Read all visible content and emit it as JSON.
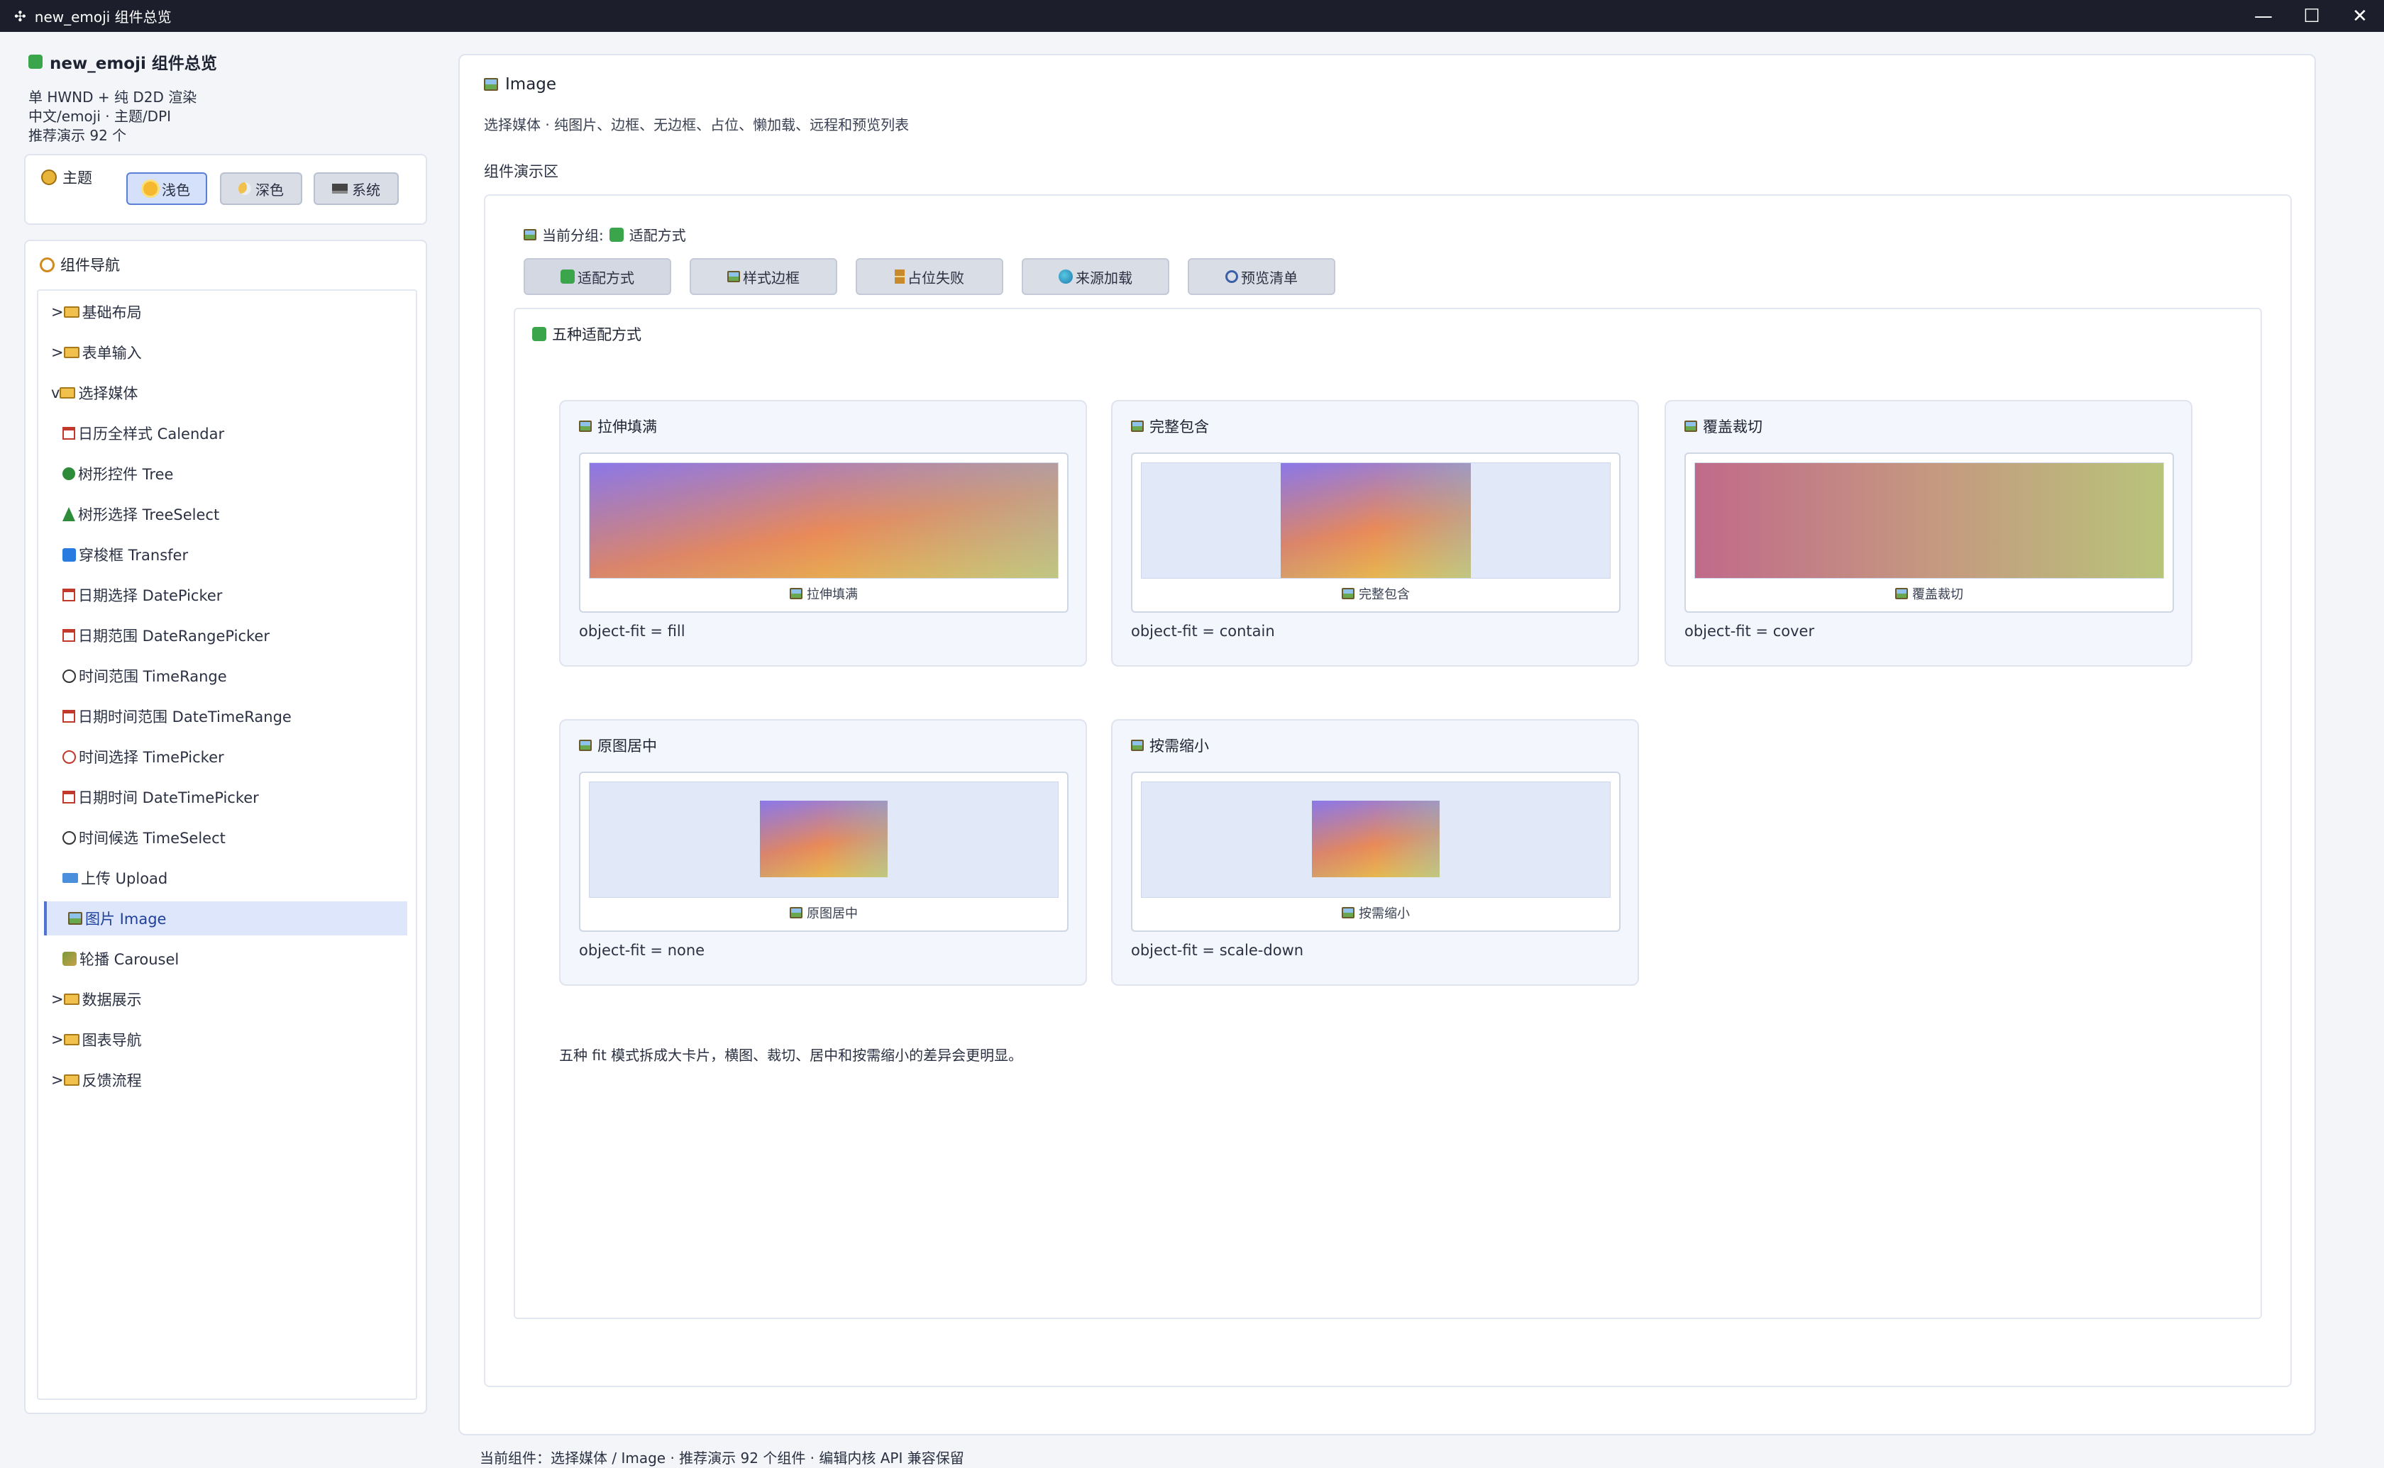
{
  "window": {
    "title": "new_emoji 组件总览",
    "minimize": "—",
    "maximize": "☐",
    "close": "✕"
  },
  "sidebar": {
    "app_name": "new_emoji 组件总览",
    "info_lines": [
      "单 HWND + 纯 D2D 渲染",
      "中文/emoji · 主题/DPI",
      "推荐演示 92 个"
    ],
    "theme": {
      "label": "主题",
      "buttons": [
        {
          "label": "浅色",
          "icon": "sun-icon",
          "active": true
        },
        {
          "label": "深色",
          "icon": "moon-icon",
          "active": false
        },
        {
          "label": "系统",
          "icon": "laptop-icon",
          "active": false
        }
      ]
    },
    "nav": {
      "label": "组件导航",
      "items": [
        {
          "prefix": ">",
          "label": "基础布局",
          "icon": "folder-icon"
        },
        {
          "prefix": ">",
          "label": "表单输入",
          "icon": "folder-icon"
        },
        {
          "prefix": "v",
          "label": "选择媒体",
          "icon": "folder-icon"
        },
        {
          "label": "日历全样式 Calendar",
          "icon": "calendar-icon"
        },
        {
          "label": "树形控件 Tree",
          "icon": "tree-icon"
        },
        {
          "label": "树形选择 TreeSelect",
          "icon": "pine-tree-icon"
        },
        {
          "label": "穿梭框 Transfer",
          "icon": "swap-icon"
        },
        {
          "label": "日期选择 DatePicker",
          "icon": "calendar-icon"
        },
        {
          "label": "日期范围 DateRangePicker",
          "icon": "calendar-icon"
        },
        {
          "label": "时间范围 TimeRange",
          "icon": "clock-icon"
        },
        {
          "label": "日期时间范围 DateTimeRange",
          "icon": "calendar-icon"
        },
        {
          "label": "时间选择 TimePicker",
          "icon": "alarm-clock-icon"
        },
        {
          "label": "日期时间 DateTimePicker",
          "icon": "calendar-icon"
        },
        {
          "label": "时间候选 TimeSelect",
          "icon": "clock-icon"
        },
        {
          "label": "上传 Upload",
          "icon": "inbox-tray-icon"
        },
        {
          "label": "图片 Image",
          "icon": "picture-icon",
          "active": true
        },
        {
          "label": "轮播 Carousel",
          "icon": "sheaf-icon"
        },
        {
          "prefix": ">",
          "label": "数据展示",
          "icon": "folder-icon"
        },
        {
          "prefix": ">",
          "label": "图表导航",
          "icon": "folder-icon"
        },
        {
          "prefix": ">",
          "label": "反馈流程",
          "icon": "folder-icon"
        }
      ]
    }
  },
  "main": {
    "title": "Image",
    "description": "选择媒体 · 纯图片、边框、无边框、占位、懒加载、远程和预览列表",
    "demo_label": "组件演示区",
    "current_group_label": "当前分组:",
    "current_group_value": "适配方式",
    "tabs": [
      {
        "label": "适配方式",
        "icon": "puzzle-icon",
        "active": true
      },
      {
        "label": "样式边框",
        "icon": "picture-icon"
      },
      {
        "label": "占位失败",
        "icon": "hourglass-icon"
      },
      {
        "label": "来源加载",
        "icon": "globe-icon"
      },
      {
        "label": "预览清单",
        "icon": "magnifier-icon"
      }
    ],
    "section_title": "五种适配方式",
    "cards": [
      {
        "title": "拉伸填满",
        "caption": "拉伸填满",
        "fit": "object-fit = fill",
        "mode": "fill"
      },
      {
        "title": "完整包含",
        "caption": "完整包含",
        "fit": "object-fit = contain",
        "mode": "contain"
      },
      {
        "title": "覆盖裁切",
        "caption": "覆盖裁切",
        "fit": "object-fit = cover",
        "mode": "cover"
      },
      {
        "title": "原图居中",
        "caption": "原图居中",
        "fit": "object-fit = none",
        "mode": "none"
      },
      {
        "title": "按需缩小",
        "caption": "按需缩小",
        "fit": "object-fit = scale-down",
        "mode": "scale-down"
      }
    ],
    "footnote": "五种 fit 模式拆成大卡片，横图、裁切、居中和按需缩小的差异会更明显。"
  },
  "status": "当前组件：选择媒体 / Image · 推荐演示 92 个组件 · 编辑内核 API 兼容保留"
}
